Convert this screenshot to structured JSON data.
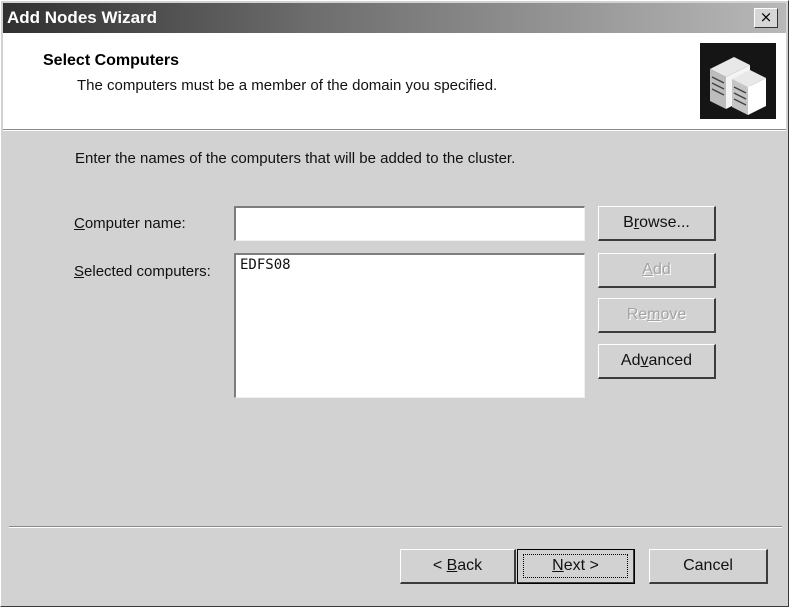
{
  "window": {
    "title": "Add Nodes Wizard",
    "close_glyph": "×"
  },
  "header": {
    "title": "Select Computers",
    "subtitle": "The computers must be a member of the domain you specified.",
    "icon": "servers-icon"
  },
  "body": {
    "instruction": "Enter the names of the computers that will be added to the cluster.",
    "computer_name": {
      "label_mnemonic": "C",
      "label_rest": "omputer name:",
      "value": ""
    },
    "selected_computers": {
      "label_mnemonic": "S",
      "label_rest": "elected computers:",
      "items": [
        "EDFS08"
      ]
    },
    "buttons": {
      "browse": {
        "pre": "B",
        "mn": "r",
        "post": "owse..."
      },
      "add": {
        "pre": "",
        "mn": "A",
        "post": "dd",
        "enabled": false
      },
      "remove": {
        "pre": "Re",
        "mn": "m",
        "post": "ove",
        "enabled": false
      },
      "advanced": {
        "pre": "Ad",
        "mn": "v",
        "post": "anced"
      }
    }
  },
  "footer": {
    "back": {
      "pre": "< ",
      "mn": "B",
      "post": "ack"
    },
    "next": {
      "pre": "",
      "mn": "N",
      "post": "ext >"
    },
    "cancel": "Cancel"
  }
}
